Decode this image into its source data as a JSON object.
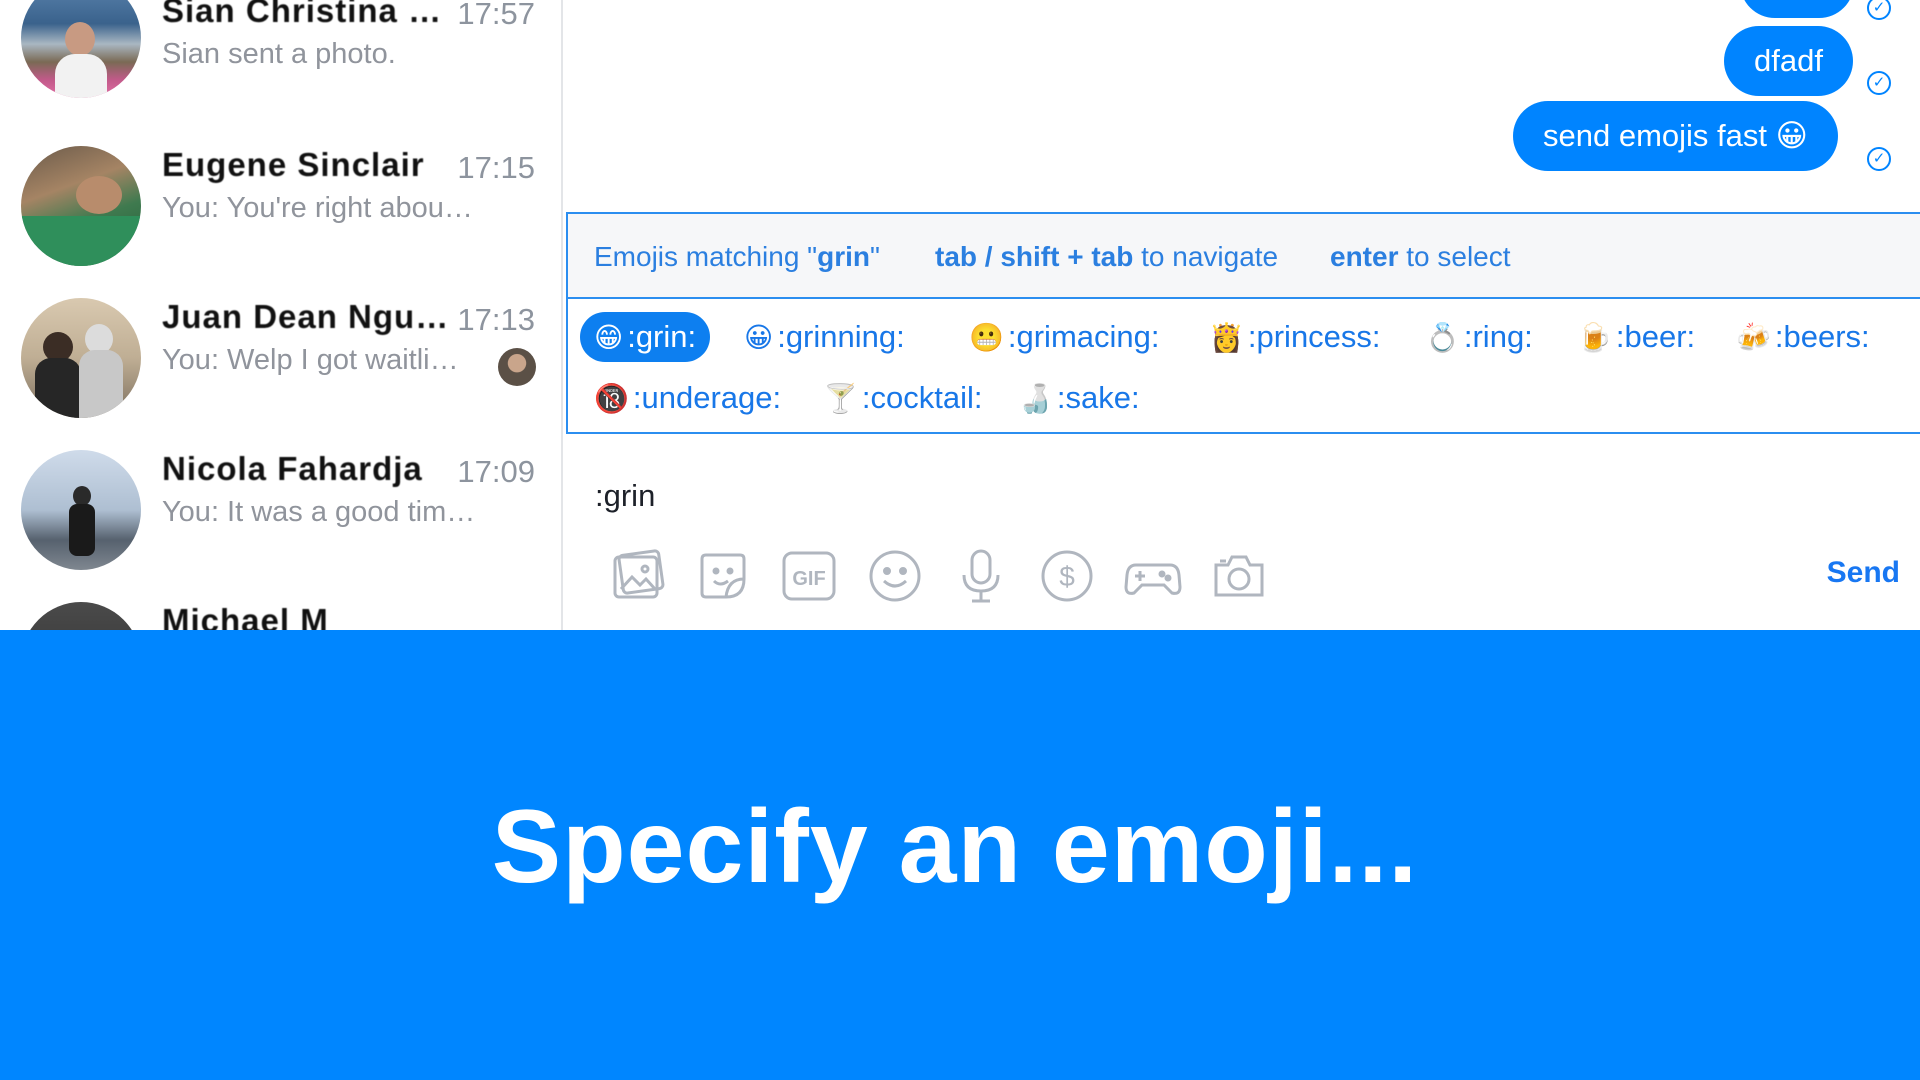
{
  "sidebar": {
    "conversations": [
      {
        "name": "Sian Christina Wi...",
        "time": "17:57",
        "snippet": "Sian sent a photo."
      },
      {
        "name": "Eugene Sinclair",
        "time": "17:15",
        "snippet": "You: You're right abou…"
      },
      {
        "name": "Juan Dean Nguyen",
        "time": "17:13",
        "snippet": "You: Welp I got waitlis…"
      },
      {
        "name": "Nicola Fahardja",
        "time": "17:09",
        "snippet": "You: It was a good tim…"
      },
      {
        "name": "Michael M",
        "time": "",
        "snippet": ""
      }
    ]
  },
  "chat": {
    "messages": [
      {
        "text": ""
      },
      {
        "text": "dfadf"
      },
      {
        "text": "send emojis fast 😀"
      }
    ],
    "emoji_panel": {
      "hint_matching_prefix": "Emojis matching \"",
      "hint_matching_query": "grin",
      "hint_matching_suffix": "\"",
      "hint_nav_keys": "tab / shift + tab",
      "hint_nav_text": " to navigate",
      "hint_select_key": "enter",
      "hint_select_text": " to select",
      "options": [
        {
          "glyph": "😁",
          "label": ":grin:"
        },
        {
          "glyph": "😀",
          "label": ":grinning:"
        },
        {
          "glyph": "😬",
          "label": ":grimacing:"
        },
        {
          "glyph": "👸",
          "label": ":princess:"
        },
        {
          "glyph": "💍",
          "label": ":ring:"
        },
        {
          "glyph": "🍺",
          "label": ":beer:"
        },
        {
          "glyph": "🍻",
          "label": ":beers:"
        },
        {
          "glyph": "🔞",
          "label": ":underage:"
        },
        {
          "glyph": "🍸",
          "label": ":cocktail:"
        },
        {
          "glyph": "🍶",
          "label": ":sake:"
        }
      ],
      "selected_index": 0
    },
    "composer": {
      "text": ":grin",
      "send_label": "Send",
      "tools": [
        "photo-icon",
        "sticker-icon",
        "gif-icon",
        "emoji-icon",
        "microphone-icon",
        "payment-icon",
        "game-icon",
        "camera-icon"
      ],
      "gif_label": "GIF"
    }
  },
  "banner": {
    "text": "Specify an emoji..."
  },
  "colors": {
    "accent": "#0084ff",
    "banner": "#0086ff"
  }
}
